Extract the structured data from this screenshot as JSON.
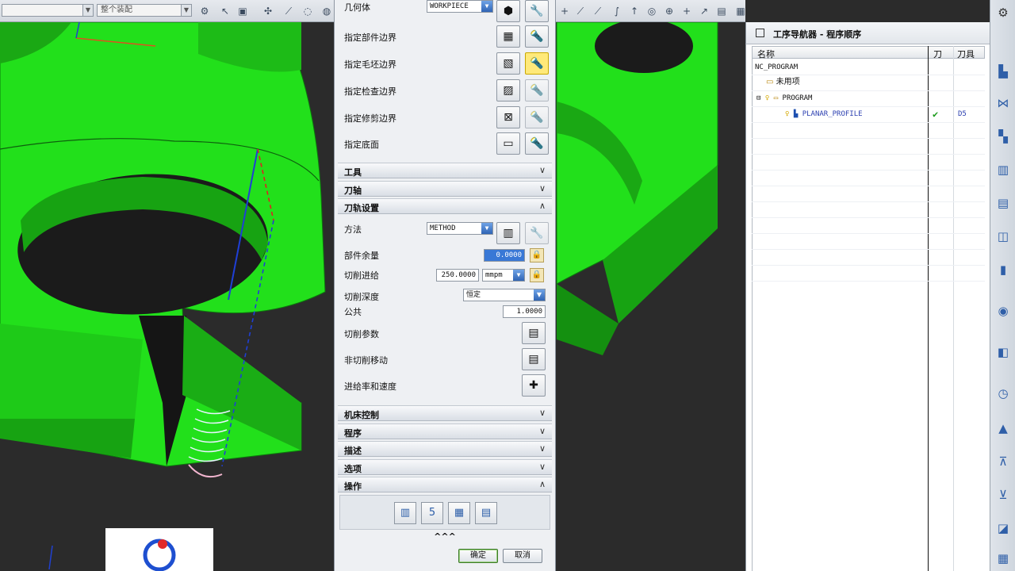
{
  "toolbar": {
    "filter_select": "",
    "snap_select": "整个装配",
    "icons": [
      "snap-icon",
      "selection-icon",
      "filter-icon",
      "point-icon",
      "line-icon",
      "arc-icon",
      "circle-icon",
      "plus-icon",
      "layer-icon"
    ]
  },
  "dialog": {
    "geometry": {
      "label": "几何体",
      "value": "WORKPIECE"
    },
    "boundaries": [
      {
        "label": "指定部件边界"
      },
      {
        "label": "指定毛坯边界"
      },
      {
        "label": "指定检查边界"
      },
      {
        "label": "指定修剪边界"
      },
      {
        "label": "指定底面"
      }
    ],
    "sections": {
      "tool": "工具",
      "axis": "刀轴",
      "path_settings": "刀轨设置",
      "machine_control": "机床控制",
      "program": "程序",
      "description": "描述",
      "options": "选项",
      "actions": "操作"
    },
    "path": {
      "method_label": "方法",
      "method_value": "METHOD",
      "stock_label": "部件余量",
      "stock_value": "0.0000",
      "feed_label": "切削进给",
      "feed_value": "250.0000",
      "feed_unit": "mmpm",
      "depth_label": "切削深度",
      "depth_value": "恒定",
      "common_label": "公共",
      "common_value": "1.0000",
      "cut_params_label": "切削参数",
      "non_cut_label": "非切削移动",
      "feeds_speeds_label": "进给率和速度"
    },
    "expand_glyph": "^^^",
    "ok": "确定",
    "cancel": "取消"
  },
  "navigator": {
    "title": "工序导航器 - 程序顺序",
    "columns": {
      "name": "名称",
      "tool_change": "刀",
      "tool": "刀具"
    },
    "tree": [
      {
        "label": "NC_PROGRAM"
      },
      {
        "label": "未用项"
      },
      {
        "label": "PROGRAM"
      },
      {
        "label": "PLANAR_PROFILE",
        "check": "✔",
        "tool": "D5"
      }
    ]
  },
  "colors": {
    "part_green": "#22e01b",
    "dialog_bg": "#eef0f3",
    "selected_field": "#3978d6",
    "check_green": "#1a9a1a"
  }
}
